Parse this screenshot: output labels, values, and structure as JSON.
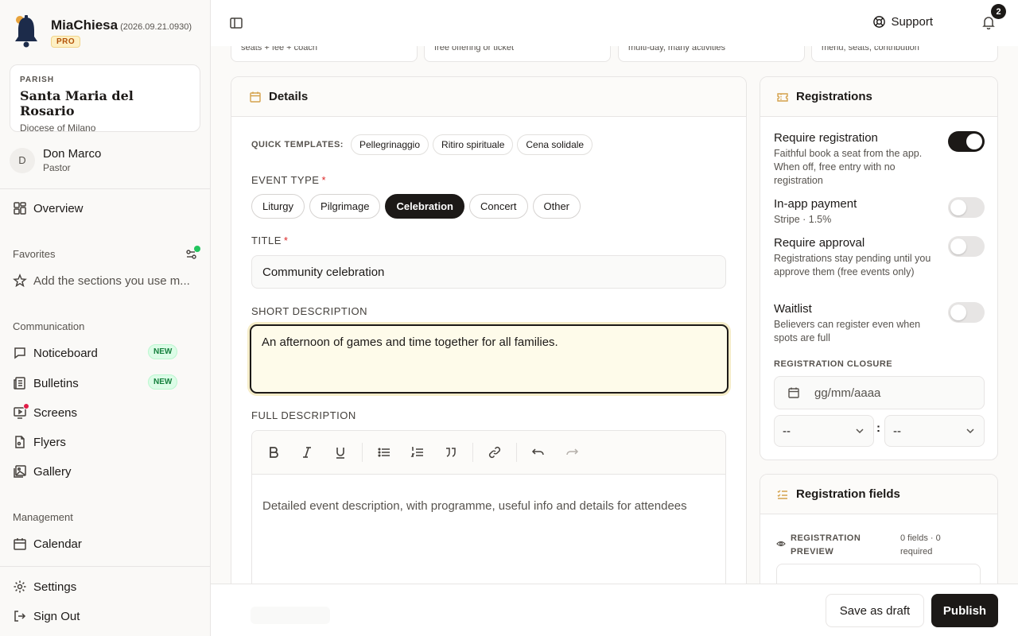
{
  "app": {
    "name": "MiaChiesa",
    "version": "(2026.09.21.0930)",
    "plan_badge": "PRO"
  },
  "parish": {
    "kicker": "PARISH",
    "name": "Santa Maria del Rosario",
    "diocese": "Diocese of Milano"
  },
  "user": {
    "initial": "D",
    "name": "Don Marco",
    "role": "Pastor"
  },
  "nav": {
    "overview": "Overview",
    "favorites_title": "Favorites",
    "favorites_empty": "Add the sections you use m...",
    "communication_title": "Communication",
    "noticeboard": "Noticeboard",
    "bulletins": "Bulletins",
    "new_badge": "NEW",
    "screens": "Screens",
    "flyers": "Flyers",
    "gallery": "Gallery",
    "management_title": "Management",
    "calendar": "Calendar",
    "settings": "Settings",
    "sign_out": "Sign Out"
  },
  "topbar": {
    "support": "Support",
    "notifications_count": "2"
  },
  "templates_row": [
    "seats + fee + coach",
    "free offering or ticket",
    "multi-day, many activities",
    "menu, seats, contribution"
  ],
  "details": {
    "title": "Details",
    "quick_templates_label": "QUICK TEMPLATES:",
    "quick_templates": [
      "Pellegrinaggio",
      "Ritiro spirituale",
      "Cena solidale"
    ],
    "event_type_label": "EVENT TYPE",
    "event_types": [
      "Liturgy",
      "Pilgrimage",
      "Celebration",
      "Concert",
      "Other"
    ],
    "event_type_selected": "Celebration",
    "required_mark": "*",
    "title_label": "TITLE",
    "title_value": "Community celebration",
    "short_desc_label": "SHORT DESCRIPTION",
    "short_desc_value": "An afternoon of games and time together for all families.",
    "full_desc_label": "FULL DESCRIPTION",
    "full_desc_placeholder": "Detailed event description, with programme, useful info and details for attendees"
  },
  "registrations": {
    "title": "Registrations",
    "options": [
      {
        "title": "Require registration",
        "desc": "Faithful book a seat from the app. When off, free entry with no registration",
        "on": true
      },
      {
        "title": "In-app payment",
        "desc": "Stripe · 1.5%",
        "on": false
      },
      {
        "title": "Require approval",
        "desc": "Registrations stay pending until you approve them (free events only)",
        "on": false
      },
      {
        "title": "Waitlist",
        "desc": "Believers can register even when spots are full",
        "on": false
      }
    ],
    "closure_label": "REGISTRATION CLOSURE",
    "date_placeholder": "gg/mm/aaaa",
    "hour_value": "--",
    "minute_value": "--",
    "time_sep": ":"
  },
  "registration_fields": {
    "title": "Registration fields",
    "preview_label": "REGISTRATION PREVIEW",
    "count": "0 fields · 0 required"
  },
  "footer": {
    "save_draft": "Save as draft",
    "publish": "Publish"
  },
  "colors": {
    "accent": "#1c1917",
    "brand_gold": "#d4a24c",
    "new_green": "#15803d",
    "alert_red": "#e11d48"
  }
}
